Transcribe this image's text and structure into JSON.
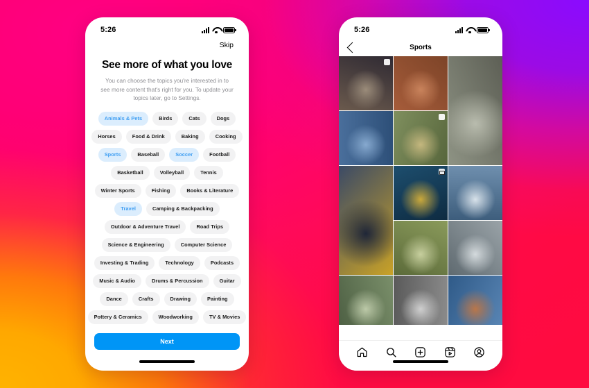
{
  "background": {
    "colors": [
      "#ff0080",
      "#8a0bff",
      "#ffb300",
      "#ff0a45"
    ],
    "description": "instagram-brand-gradient"
  },
  "left_phone": {
    "status_bar": {
      "time": "5:26",
      "icons": [
        "signal-icon",
        "wifi-icon",
        "battery-icon"
      ]
    },
    "skip_label": "Skip",
    "headline": "See more of what you love",
    "subhead": "You can choose the topics you're interested in to see more content that's right for you. To update your topics later, go to Settings.",
    "accent_color": "#0095f6",
    "chip_selected_bg": "#dbedfd",
    "chip_selected_text": "#3f9ef2",
    "chip_rows": [
      [
        {
          "label": "Animals & Pets",
          "selected": true
        },
        {
          "label": "Birds",
          "selected": false
        },
        {
          "label": "Cats",
          "selected": false
        },
        {
          "label": "Dogs",
          "selected": false
        }
      ],
      [
        {
          "label": "Horses",
          "selected": false
        },
        {
          "label": "Food & Drink",
          "selected": false
        },
        {
          "label": "Baking",
          "selected": false
        },
        {
          "label": "Cooking",
          "selected": false
        }
      ],
      [
        {
          "label": "Sports",
          "selected": true
        },
        {
          "label": "Baseball",
          "selected": false
        },
        {
          "label": "Soccer",
          "selected": true
        },
        {
          "label": "Football",
          "selected": false
        }
      ],
      [
        {
          "label": "Basketball",
          "selected": false
        },
        {
          "label": "Volleyball",
          "selected": false
        },
        {
          "label": "Tennis",
          "selected": false
        }
      ],
      [
        {
          "label": "Winter Sports",
          "selected": false
        },
        {
          "label": "Fishing",
          "selected": false
        },
        {
          "label": "Books & Literature",
          "selected": false
        }
      ],
      [
        {
          "label": "Travel",
          "selected": true
        },
        {
          "label": "Camping & Backpacking",
          "selected": false
        }
      ],
      [
        {
          "label": "Outdoor & Adventure Travel",
          "selected": false
        },
        {
          "label": "Road Trips",
          "selected": false
        }
      ],
      [
        {
          "label": "Science & Engineering",
          "selected": false
        },
        {
          "label": "Computer Science",
          "selected": false
        }
      ],
      [
        {
          "label": "Investing & Trading",
          "selected": false
        },
        {
          "label": "Technology",
          "selected": false
        },
        {
          "label": "Podcasts",
          "selected": false
        }
      ],
      [
        {
          "label": "Music & Audio",
          "selected": false
        },
        {
          "label": "Drums & Percussion",
          "selected": false
        },
        {
          "label": "Guitar",
          "selected": false
        }
      ],
      [
        {
          "label": "Dance",
          "selected": false
        },
        {
          "label": "Crafts",
          "selected": false
        },
        {
          "label": "Drawing",
          "selected": false
        },
        {
          "label": "Painting",
          "selected": false
        }
      ],
      [
        {
          "label": "Pottery & Ceramics",
          "selected": false
        },
        {
          "label": "Woodworking",
          "selected": false
        },
        {
          "label": "TV & Movies",
          "selected": false
        }
      ]
    ],
    "next_label": "Next"
  },
  "right_phone": {
    "status_bar": {
      "time": "5:26",
      "icons": [
        "signal-icon",
        "wifi-icon",
        "battery-icon"
      ]
    },
    "nav": {
      "back_icon": "back-chevron-icon",
      "title": "Sports"
    },
    "grid_cells": [
      {
        "id": "cell-1",
        "alt": "person sitting lacing skate shoes",
        "tall": false,
        "badge": "multi-photo"
      },
      {
        "id": "cell-2",
        "alt": "skateboard trick mid-air over bricks",
        "tall": false,
        "badge": null
      },
      {
        "id": "cell-3",
        "alt": "man leaping in split by brick stairs",
        "tall": true,
        "badge": null
      },
      {
        "id": "cell-4",
        "alt": "two skateboarders against blue sky",
        "tall": false,
        "badge": null
      },
      {
        "id": "cell-5",
        "alt": "girl holding football in autumn field",
        "tall": false,
        "badge": "multi-photo"
      },
      {
        "id": "cell-6",
        "alt": "player heading a soccer ball",
        "tall": true,
        "badge": null
      },
      {
        "id": "cell-7",
        "alt": "gold soccer trophy on blue display",
        "tall": false,
        "badge": "reels"
      },
      {
        "id": "cell-8",
        "alt": "basketball dunk on outdoor court",
        "tall": false,
        "badge": null
      },
      {
        "id": "cell-9",
        "alt": "man dribbling basketball in park",
        "tall": false,
        "badge": null
      },
      {
        "id": "cell-10",
        "alt": "person balancing on slackline in woods",
        "tall": false,
        "badge": null
      },
      {
        "id": "cell-11",
        "alt": "child riding bmx bike in park",
        "tall": false,
        "badge": null
      },
      {
        "id": "cell-12",
        "alt": "skateboarder foot on board, long shadow",
        "tall": false,
        "badge": null
      },
      {
        "id": "cell-13",
        "alt": "kid holding basketball over face",
        "tall": false,
        "badge": null
      }
    ],
    "tabbar": [
      {
        "icon": "home-icon",
        "label": "Home"
      },
      {
        "icon": "search-icon",
        "label": "Search"
      },
      {
        "icon": "add-icon",
        "label": "Create"
      },
      {
        "icon": "reels-icon",
        "label": "Reels"
      },
      {
        "icon": "profile-icon",
        "label": "Profile"
      }
    ]
  }
}
